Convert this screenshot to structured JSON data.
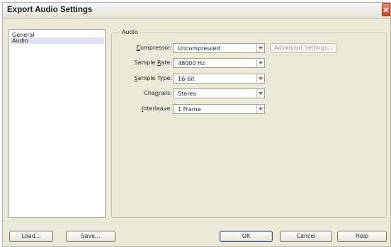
{
  "window": {
    "title": "Export Audio Settings"
  },
  "sidebar": {
    "items": [
      "General",
      "Audio"
    ]
  },
  "group": {
    "label": "Audio"
  },
  "fields": {
    "compressor": {
      "label_pre": "",
      "label_key": "C",
      "label_post": "ompressor:",
      "value": "Uncompressed"
    },
    "sample_rate": {
      "label_pre": "Sample ",
      "label_key": "R",
      "label_post": "ate:",
      "value": "48000 Hz"
    },
    "sample_type": {
      "label_pre": "",
      "label_key": "S",
      "label_post": "ample Type:",
      "value": "16-bit"
    },
    "channels": {
      "label_pre": "Cha",
      "label_key": "n",
      "label_post": "nels:",
      "value": "Stereo"
    },
    "interleave": {
      "label_pre": "",
      "label_key": "I",
      "label_post": "nterleave:",
      "value": "1 Frame"
    }
  },
  "buttons": {
    "advanced": "Advanced Settings...",
    "load": "Load...",
    "save": "Save...",
    "ok": "OK",
    "cancel": "Cancel",
    "help": "Help"
  }
}
